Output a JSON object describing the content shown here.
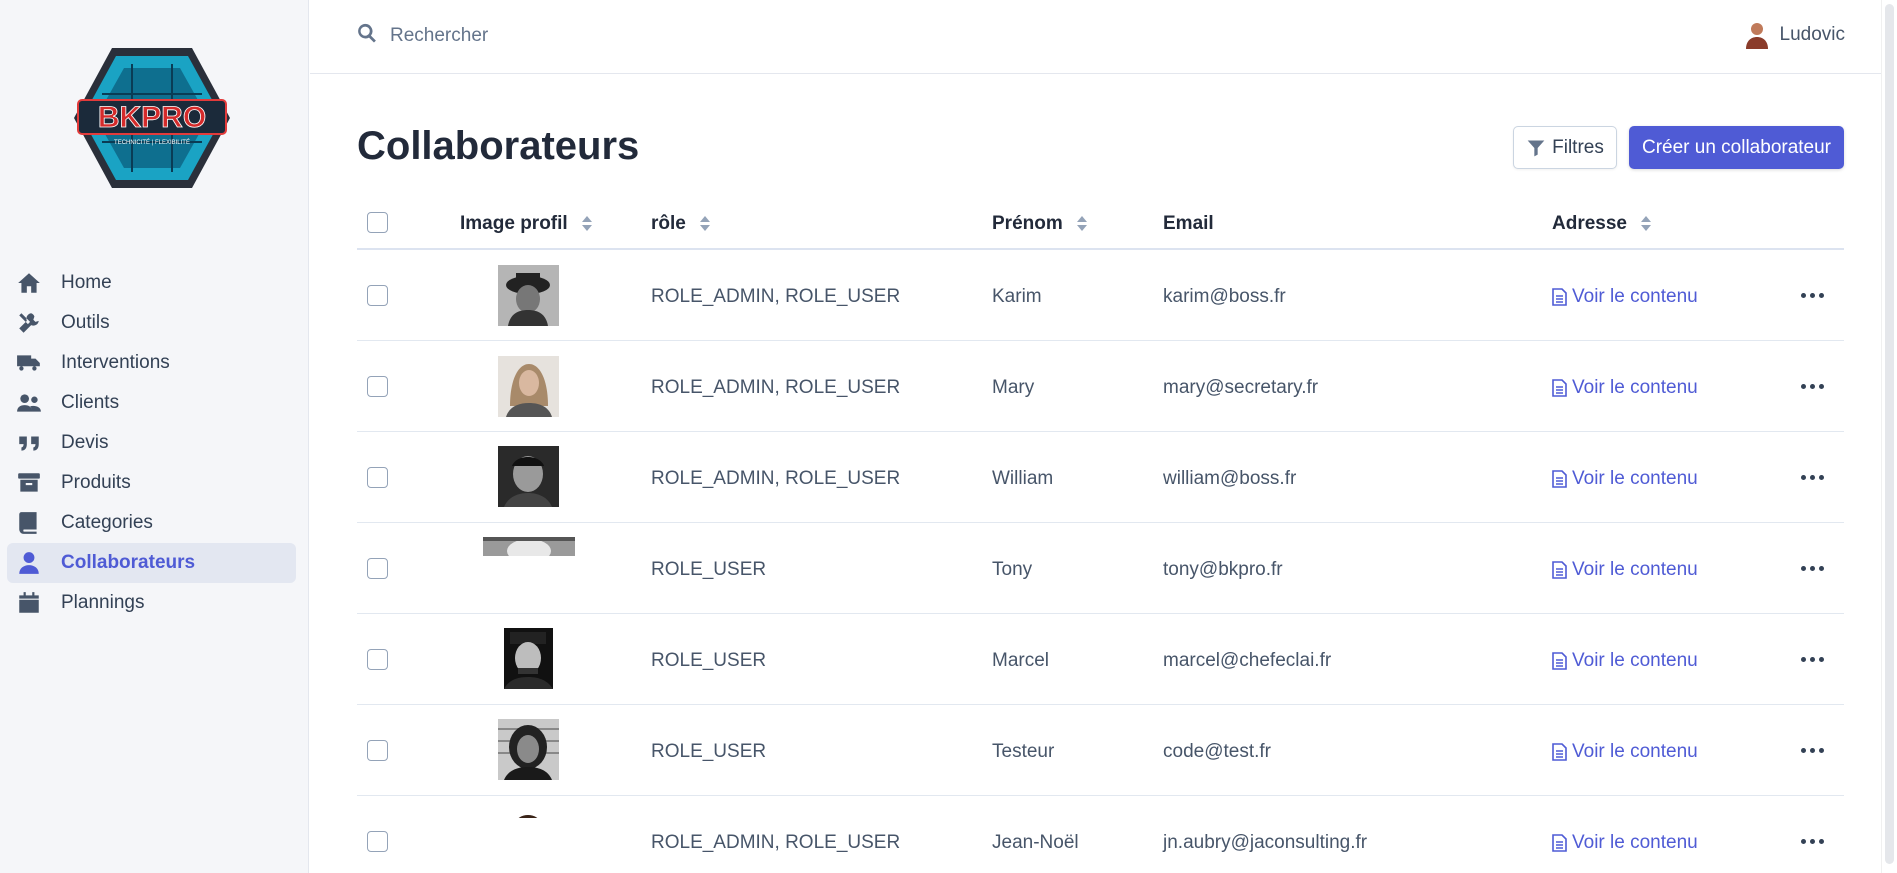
{
  "app": {
    "logo_text": "BKPRO",
    "logo_tagline": "TECHNICITÉ | FLEXIBILITÉ"
  },
  "sidebar": {
    "items": [
      {
        "label": "Home",
        "icon": "home-icon"
      },
      {
        "label": "Outils",
        "icon": "tools-icon"
      },
      {
        "label": "Interventions",
        "icon": "truck-icon"
      },
      {
        "label": "Clients",
        "icon": "users-icon"
      },
      {
        "label": "Devis",
        "icon": "quote-icon"
      },
      {
        "label": "Produits",
        "icon": "archive-icon"
      },
      {
        "label": "Categories",
        "icon": "book-icon"
      },
      {
        "label": "Collaborateurs",
        "icon": "user-icon",
        "active": true
      },
      {
        "label": "Plannings",
        "icon": "calendar-icon"
      }
    ]
  },
  "topbar": {
    "search_placeholder": "Rechercher",
    "user_name": "Ludovic"
  },
  "page": {
    "title": "Collaborateurs",
    "filter_label": "Filtres",
    "create_label": "Créer un collaborateur"
  },
  "table": {
    "headers": {
      "image": "Image profil",
      "role": "rôle",
      "firstname": "Prénom",
      "email": "Email",
      "address": "Adresse"
    },
    "rows": [
      {
        "role": "ROLE_ADMIN, ROLE_USER",
        "firstname": "Karim",
        "email": "karim@boss.fr",
        "address_link": "Voir le contenu"
      },
      {
        "role": "ROLE_ADMIN, ROLE_USER",
        "firstname": "Mary",
        "email": "mary@secretary.fr",
        "address_link": "Voir le contenu"
      },
      {
        "role": "ROLE_ADMIN, ROLE_USER",
        "firstname": "William",
        "email": "william@boss.fr",
        "address_link": "Voir le contenu"
      },
      {
        "role": "ROLE_USER",
        "firstname": "Tony",
        "email": "tony@bkpro.fr",
        "address_link": "Voir le contenu"
      },
      {
        "role": "ROLE_USER",
        "firstname": "Marcel",
        "email": "marcel@chefeclai.fr",
        "address_link": "Voir le contenu"
      },
      {
        "role": "ROLE_USER",
        "firstname": "Testeur",
        "email": "code@test.fr",
        "address_link": "Voir le contenu"
      },
      {
        "role": "ROLE_ADMIN, ROLE_USER",
        "firstname": "Jean-Noël",
        "email": "jn.aubry@jaconsulting.fr",
        "address_link": "Voir le contenu"
      }
    ]
  },
  "colors": {
    "accent": "#4f5bd5",
    "sidebar_bg": "#f5f6f9",
    "text": "#475569"
  }
}
